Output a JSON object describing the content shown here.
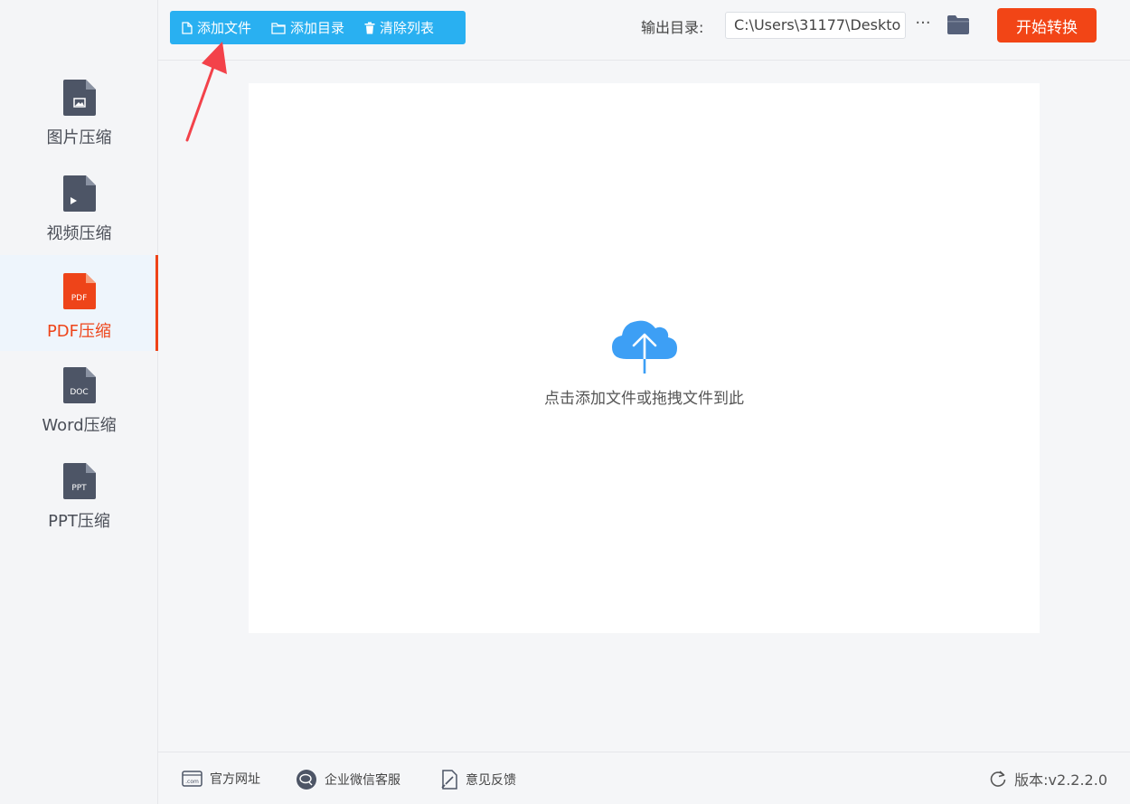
{
  "sidebar": {
    "items": [
      {
        "label": "图片压缩",
        "icon": "image-file-icon",
        "badge": ""
      },
      {
        "label": "视频压缩",
        "icon": "video-file-icon",
        "badge": ""
      },
      {
        "label": "PDF压缩",
        "icon": "pdf-file-icon",
        "badge": "PDF",
        "active": true
      },
      {
        "label": "Word压缩",
        "icon": "doc-file-icon",
        "badge": "DOC"
      },
      {
        "label": "PPT压缩",
        "icon": "ppt-file-icon",
        "badge": "PPT"
      }
    ]
  },
  "toolbar": {
    "add_file": "添加文件",
    "add_dir": "添加目录",
    "clear_list": "清除列表"
  },
  "output": {
    "label": "输出目录:",
    "path": "C:\\Users\\31177\\Deskto",
    "more": "···"
  },
  "start_button": "开始转换",
  "dropzone": {
    "hint": "点击添加文件或拖拽文件到此"
  },
  "footer": {
    "website": "官方网址",
    "wechat_support": "企业微信客服",
    "feedback": "意见反馈",
    "version": "版本:v2.2.2.0"
  },
  "colors": {
    "accent_orange": "#ee4419",
    "toolbar_blue": "#29b0f1",
    "upload_blue": "#3d9ff5",
    "annotation_red": "#f3424a"
  }
}
